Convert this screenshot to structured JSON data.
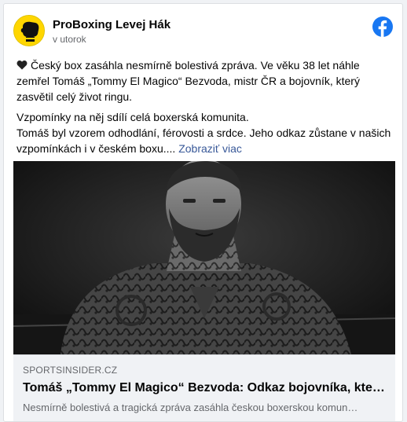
{
  "header": {
    "page_name": "ProBoxing Levej Hák",
    "time": "v utorok",
    "avatar_icon": "boxing-glove-icon",
    "network_icon": "facebook-logo-icon",
    "brand_color": "#1877f2",
    "avatar_color": "#ffd600"
  },
  "post": {
    "emoji_icon": "black-heart-icon",
    "paragraph1": "Český box zasáhla nesmírně bolestivá zpráva. Ve věku 38 let náhle zemřel Tomáš „Tommy El Magico“ Bezvoda, mistr ČR a bojovník, který zasvětil celý život ringu.",
    "paragraph2_line1": "Vzpomínky na něj sdílí celá boxerská komunita.",
    "paragraph2_line2": "Tomáš byl vzorem odhodlání, férovosti a srdce. Jeho odkaz zůstane v našich vzpomínkách i v českém boxu....",
    "see_more": "Zobraziť viac"
  },
  "link_preview": {
    "image_subject": "tattooed-bearded-boxer-photo",
    "domain": "SPORTSINSIDER.CZ",
    "title": "Tomáš „Tommy El Magico“ Bezvoda: Odkaz bojovníka, kte…",
    "description": "Nesmírně bolestivá a tragická zpráva zasáhla českou boxerskou komun…"
  }
}
